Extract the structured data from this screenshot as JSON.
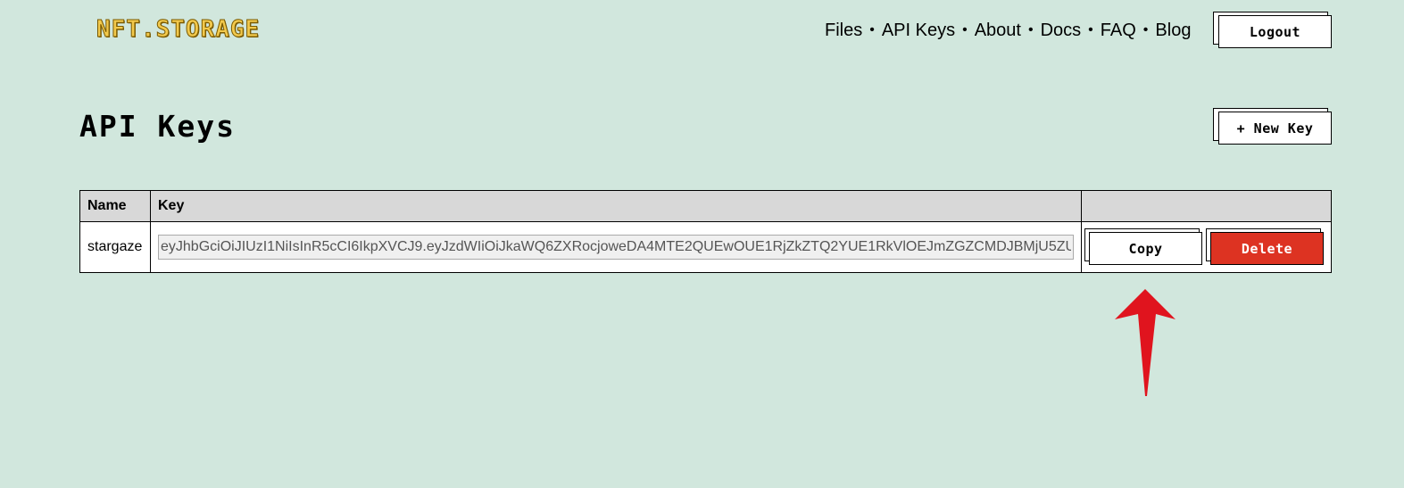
{
  "header": {
    "logo_text": "NFT.STORAGE",
    "nav": [
      {
        "label": "Files"
      },
      {
        "label": "API Keys"
      },
      {
        "label": "About"
      },
      {
        "label": "Docs"
      },
      {
        "label": "FAQ"
      },
      {
        "label": "Blog"
      }
    ],
    "nav_separator": "•",
    "logout_label": "Logout"
  },
  "main": {
    "title": "API Keys",
    "new_key_label": "+ New Key",
    "table": {
      "headers": [
        "Name",
        "Key",
        ""
      ],
      "rows": [
        {
          "name": "stargaze",
          "key": "eyJhbGciOiJIUzI1NiIsInR5cCI6IkpXVCJ9.eyJzdWIiOiJkaWQ6ZXRocjoweDA4MTE2QUEwOUE1RjZkZTQ2YUE1RkVlOEJmZGZCMDJBMjU5ZU",
          "copy_label": "Copy",
          "delete_label": "Delete"
        }
      ]
    }
  },
  "colors": {
    "background": "#d1e7dd",
    "delete_button": "#dd3322",
    "annotation_arrow": "#e0141e",
    "logo": "#f2c94c"
  },
  "annotation": {
    "icon": "red-arrow-up-icon"
  }
}
